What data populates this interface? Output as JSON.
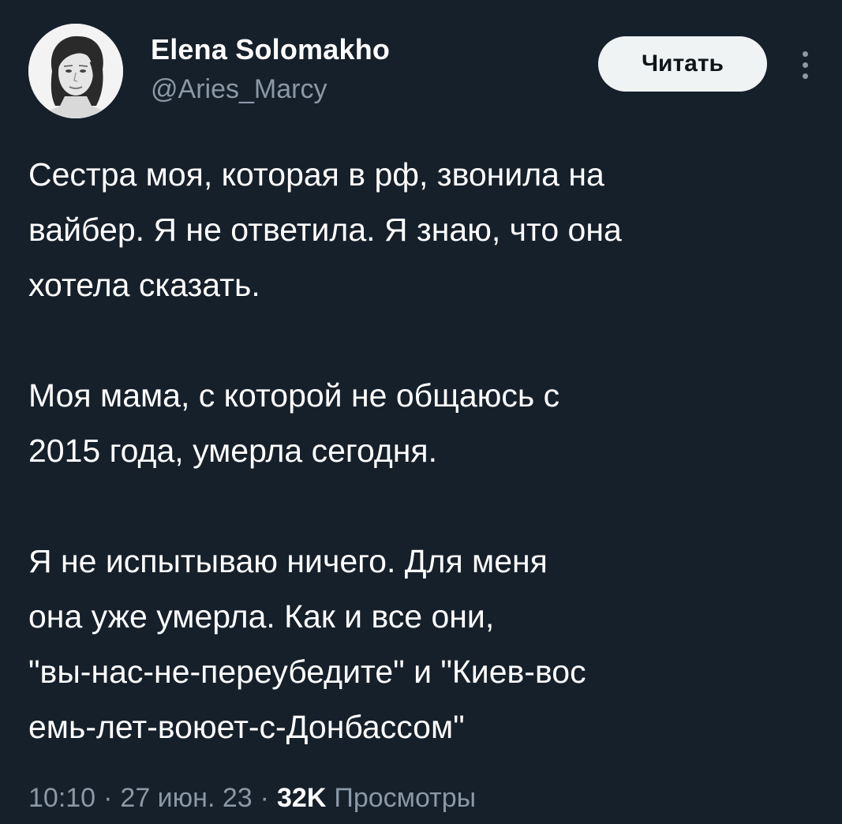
{
  "author": {
    "name": "Elena Solomakho",
    "handle": "@Aries_Marcy",
    "avatar_icon": "user-photo-avatar"
  },
  "header": {
    "follow_label": "Читать",
    "more_icon": "vertical-ellipsis-icon"
  },
  "tweet": {
    "lines": [
      "Сестра моя, которая в рф, звонила на",
      "вайбер. Я не ответила. Я знаю, что она",
      "хотела сказать.",
      "",
      "Моя мама, с которой не общаюсь с",
      "2015 года, умерла сегодня.",
      "",
      "Я не испытываю ничего. Для меня",
      "она уже умерла. Как и все они,",
      "\"вы-нас-не-переубедите\" и \"Киев-вос",
      "емь-лет-воюет-с-Донбассом\""
    ]
  },
  "meta": {
    "time": "10:10",
    "separator": "·",
    "date": "27 июн. 23",
    "views_count": "32K",
    "views_label": "Просмотры"
  },
  "colors": {
    "background": "#15202b",
    "text_primary": "#ffffff",
    "text_secondary": "#8b98a5",
    "button_bg": "#eff3f4",
    "button_text": "#0f1419"
  }
}
